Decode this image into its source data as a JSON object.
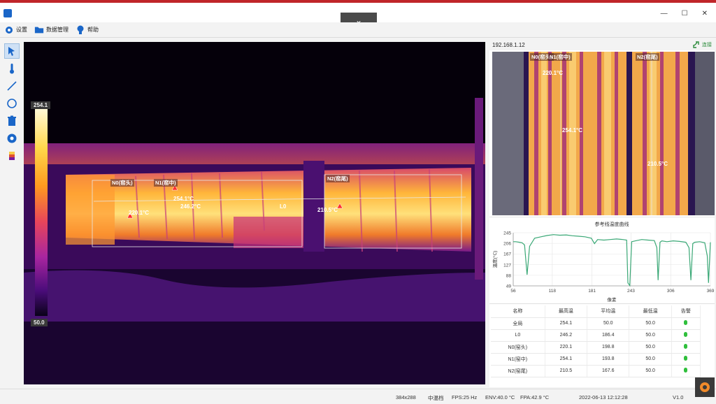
{
  "window": {
    "title": "",
    "collapse_glyph": "⌄",
    "controls": [
      "—",
      "☐",
      "✕"
    ]
  },
  "menu": [
    {
      "icon": "gear-icon",
      "label": "设置"
    },
    {
      "icon": "folder-icon",
      "label": "数据管理"
    },
    {
      "icon": "bulb-icon",
      "label": "帮助"
    }
  ],
  "tools": [
    "pointer-icon",
    "thermometer-icon",
    "line-icon",
    "circle-icon",
    "trash-icon",
    "gear-icon",
    "palette-icon"
  ],
  "thermal": {
    "scale_max": "254.1",
    "scale_min": "50.0",
    "markers": [
      {
        "name": "N0(窑头)",
        "temp": "220.1°C"
      },
      {
        "name": "N1(窑中)",
        "temp": "254.1°C"
      },
      {
        "name": "L0-temp",
        "temp": "246.2°C"
      },
      {
        "name": "L0",
        "temp": ""
      },
      {
        "name": "N2(窑尾)",
        "temp": "210.5°C"
      }
    ]
  },
  "right": {
    "ip": "192.168.1.12",
    "connect_label": "连接",
    "ref_labels": {
      "n0": "N0(窑头)",
      "n1": "N1(窑中)",
      "n2": "N2(窑尾)",
      "t1": "220.1°C",
      "t2": "254.1°C",
      "t3": "210.5°C"
    }
  },
  "chart_data": {
    "type": "line",
    "title": "参考线温度曲线",
    "xlabel": "像素",
    "ylabel": "温度(°C)",
    "x_ticks": [
      "56",
      "118",
      "181",
      "243",
      "306",
      "369"
    ],
    "y_ticks": [
      "49",
      "88",
      "127",
      "167",
      "206",
      "245"
    ],
    "xlim": [
      56,
      369
    ],
    "ylim": [
      49,
      245
    ],
    "x": [
      56,
      60,
      66,
      70,
      74,
      78,
      82,
      90,
      100,
      110,
      120,
      130,
      140,
      150,
      160,
      170,
      180,
      185,
      190,
      200,
      210,
      220,
      230,
      236,
      238,
      241,
      244,
      250,
      260,
      270,
      280,
      284,
      286,
      289,
      292,
      300,
      310,
      320,
      330,
      335,
      338,
      341,
      344,
      352,
      360,
      364,
      366,
      369
    ],
    "y": [
      212,
      212,
      210,
      208,
      200,
      90,
      195,
      225,
      230,
      235,
      238,
      236,
      237,
      234,
      232,
      230,
      225,
      205,
      220,
      218,
      220,
      222,
      220,
      218,
      60,
      50,
      212,
      215,
      220,
      218,
      216,
      190,
      70,
      210,
      215,
      212,
      215,
      213,
      210,
      190,
      70,
      205,
      210,
      212,
      208,
      160,
      60,
      210
    ],
    "color": "#3aa876",
    "grid": true
  },
  "table": {
    "headers": [
      "名称",
      "最高温",
      "平均温",
      "最低温",
      "告警"
    ],
    "rows": [
      [
        "全局",
        "254.1",
        "50.0",
        "50.0"
      ],
      [
        "L0",
        "246.2",
        "186.4",
        "50.0"
      ],
      [
        "N0(窑头)",
        "220.1",
        "198.8",
        "50.0"
      ],
      [
        "N1(窑中)",
        "254.1",
        "193.8",
        "50.0"
      ],
      [
        "N2(窑尾)",
        "210.5",
        "167.6",
        "50.0"
      ]
    ]
  },
  "status": {
    "resolution": "384x288",
    "mode": "中温档",
    "fps": "FPS:25 Hz",
    "env": "ENV:40.0 °C",
    "fpa": "FPA:42.9 °C",
    "datetime": "2022-06-13 12:12:28",
    "version": "V1.0"
  }
}
